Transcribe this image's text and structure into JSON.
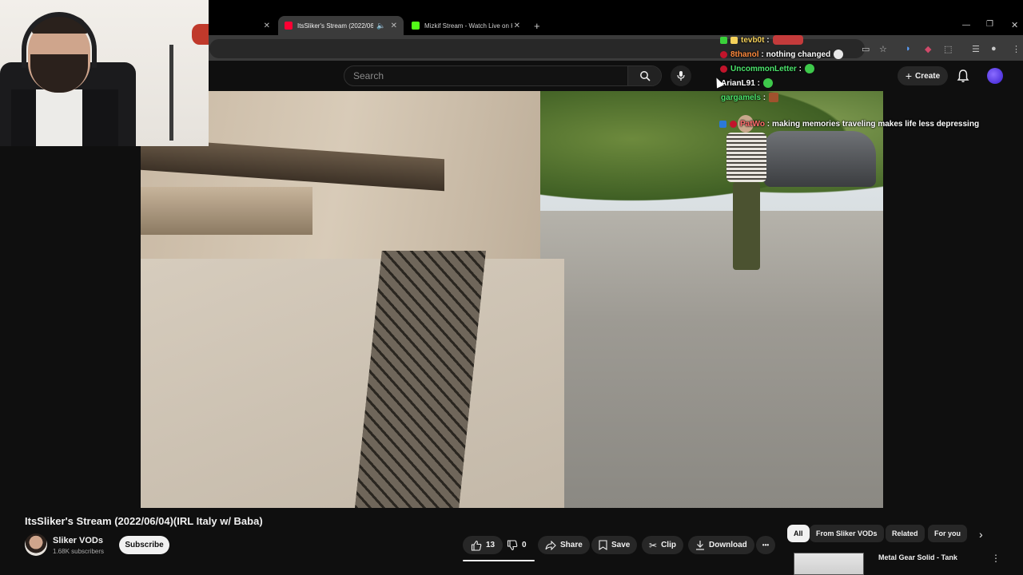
{
  "browser": {
    "tabs": [
      {
        "title": "",
        "active": false
      },
      {
        "title": "ItsSliker's Stream (2022/06/",
        "active": true,
        "favicon_color": "#ff0033"
      },
      {
        "title": "Mizkif Stream - Watch Live on K",
        "active": false,
        "favicon_color": "#53fc18"
      }
    ],
    "new_tab_symbol": "+"
  },
  "youtube": {
    "search_placeholder": "Search",
    "create_label": "Create"
  },
  "chat": [
    {
      "user": "tevb0t",
      "text": "",
      "color": "#f5d15a",
      "badge_color": "#3ad13a"
    },
    {
      "user": "8thanol",
      "text": "nothing changed",
      "color": "#ff8a3d",
      "badge_color": "#c2142b"
    },
    {
      "user": "UncommonLetter",
      "text": "",
      "color": "#4be36b",
      "badge_color": "#c2142b"
    },
    {
      "user": "ArianL91",
      "text": "",
      "color": "#ffffff",
      "badge_color": "#000000"
    },
    {
      "user": "gargamels",
      "text": "",
      "color": "#4be36b",
      "badge_color": "#000000"
    },
    {
      "user": "PatWo",
      "text": "making memories traveling makes life less depressing",
      "color": "#ff6b6b",
      "badge_color": "#2b79d8"
    }
  ],
  "video": {
    "title": "ItsSliker's Stream (2022/06/04)(IRL Italy w/ Baba)",
    "channel": "Sliker VODs",
    "subscribers": "1.68K subscribers",
    "subscribe_label": "Subscribe",
    "likes": "13",
    "dislikes": "0",
    "share_label": "Share",
    "save_label": "Save",
    "clip_label": "Clip",
    "download_label": "Download",
    "more_label": "•••"
  },
  "filters": {
    "chips": [
      "All",
      "From Sliker VODs",
      "Related",
      "For you"
    ]
  },
  "recommendation": {
    "title": "Metal Gear Solid - Tank"
  },
  "colors": {
    "background": "#0f0f0f",
    "surface": "#272727",
    "text": "#f1f1f1",
    "youtube_red": "#ff0033"
  }
}
